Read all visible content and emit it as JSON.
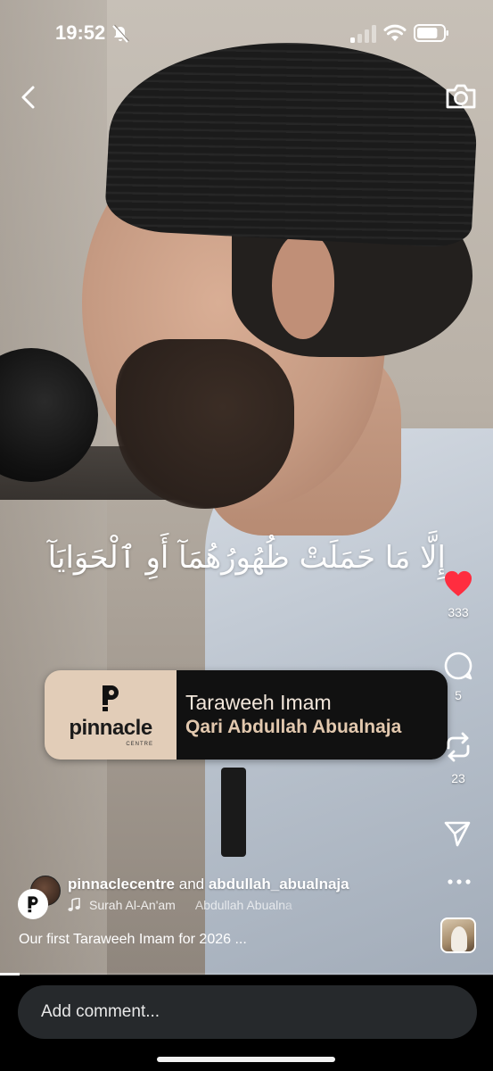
{
  "status_bar": {
    "time": "19:52",
    "silent_mode": true,
    "signal_bars_filled": 1,
    "battery_level": 0.8
  },
  "video": {
    "subtitle_arabic": "إِلَّا مَا حَمَلَتْ ظُهُورُهُمَآ أَوِ ٱلْحَوَايَآ",
    "progress": 0.04
  },
  "banner": {
    "logo_word": "pinnacle",
    "logo_sub": "CENTRE",
    "title": "Taraweeh Imam",
    "name": "Qari Abdullah Abualnaja"
  },
  "actions": {
    "like_count": "333",
    "liked": true,
    "like_color": "#ff2d3f",
    "comment_count": "5",
    "repost_count": "23"
  },
  "post": {
    "owner": "pinnaclecentre",
    "joiner": "and",
    "collaborator": "abdullah_abualnaja",
    "audio_title": "Surah Al-An'am",
    "audio_artist": "Abdullah Abualna",
    "caption": "Our first Taraweeh Imam for 2026 ..."
  },
  "comment_bar": {
    "placeholder": "Add comment..."
  },
  "icons": {
    "back": "chevron-left-icon",
    "camera": "camera-icon",
    "comment": "speech-bubble-icon",
    "repost": "repost-arrows-icon",
    "share": "paper-plane-icon",
    "more": "ellipsis-icon",
    "audio": "music-note-icon"
  }
}
